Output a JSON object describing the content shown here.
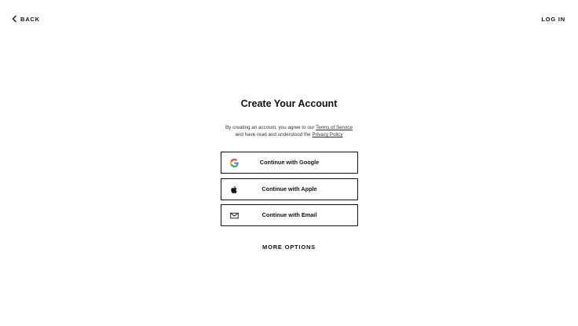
{
  "nav": {
    "back_label": "BACK",
    "login_label": "LOG IN"
  },
  "main": {
    "title": "Create Your Account",
    "legal": {
      "line1_prefix": "By creating an account, you agree to our ",
      "terms_link": "Terms of Service",
      "line2_prefix": "and have read and understood the ",
      "privacy_link": "Privacy Policy"
    },
    "buttons": [
      {
        "label": "Continue with Google",
        "icon": "google-icon"
      },
      {
        "label": "Continue with Apple",
        "icon": "apple-icon"
      },
      {
        "label": "Continue with Email",
        "icon": "mail-icon"
      }
    ],
    "more_options_label": "MORE OPTIONS"
  },
  "colors": {
    "text": "#111111",
    "border": "#111111",
    "background": "#ffffff",
    "google_blue": "#4285F4",
    "google_red": "#EA4335",
    "google_yellow": "#FBBC05",
    "google_green": "#34A853"
  }
}
